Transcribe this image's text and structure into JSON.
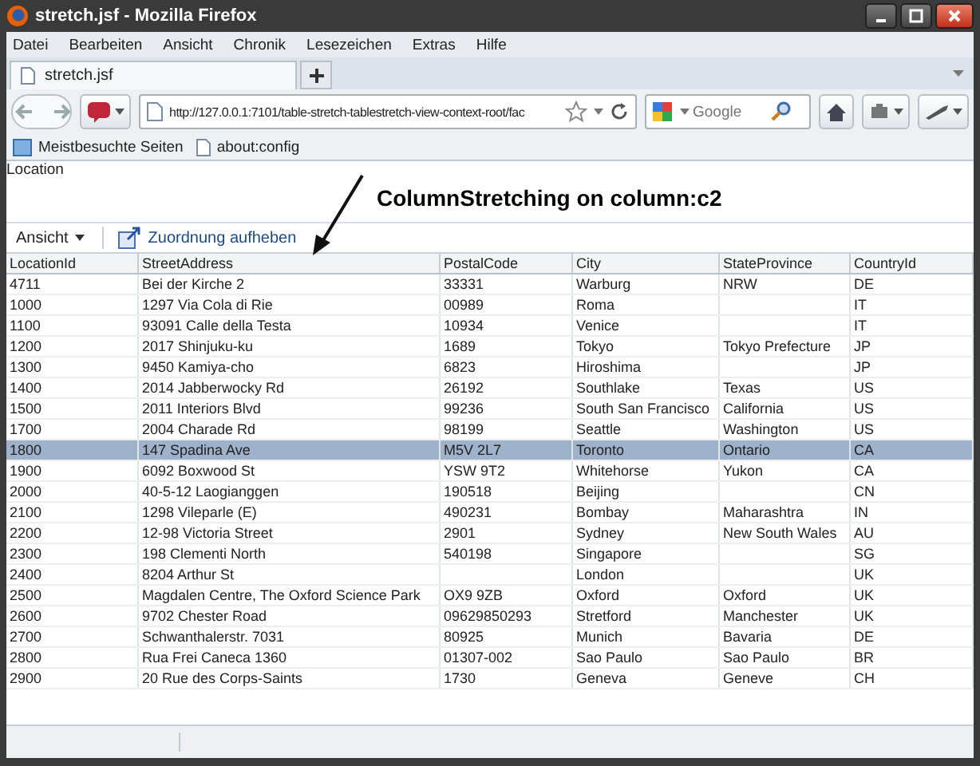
{
  "window": {
    "title": "stretch.jsf - Mozilla Firefox"
  },
  "menu": [
    "Datei",
    "Bearbeiten",
    "Ansicht",
    "Chronik",
    "Lesezeichen",
    "Extras",
    "Hilfe"
  ],
  "tabs": [
    {
      "label": "stretch.jsf",
      "selected": true
    }
  ],
  "address": "http://127.0.0.1:7101/table-stretch-tablestretch-view-context-root/fac",
  "search": {
    "placeholder": "Google"
  },
  "bookmarks": [
    "Meistbesuchte Seiten",
    "about:config"
  ],
  "page": {
    "heading": "Location",
    "annotation": "ColumnStretching on column:c2",
    "view_menu": "Ansicht",
    "detach": "Zuordnung aufheben"
  },
  "table": {
    "columns": [
      "LocationId",
      "StreetAddress",
      "PostalCode",
      "City",
      "StateProvince",
      "CountryId"
    ],
    "rows": [
      {
        "cells": [
          "4711",
          "Bei der Kirche 2",
          "33331",
          "Warburg",
          "NRW",
          "DE"
        ],
        "selected": false
      },
      {
        "cells": [
          "1000",
          "1297 Via Cola di Rie",
          "00989",
          "Roma",
          "",
          "IT"
        ],
        "selected": false
      },
      {
        "cells": [
          "1100",
          "93091 Calle della Testa",
          "10934",
          "Venice",
          "",
          "IT"
        ],
        "selected": false
      },
      {
        "cells": [
          "1200",
          "2017 Shinjuku-ku",
          "1689",
          "Tokyo",
          "Tokyo Prefecture",
          "JP"
        ],
        "selected": false
      },
      {
        "cells": [
          "1300",
          "9450 Kamiya-cho",
          "6823",
          "Hiroshima",
          "",
          "JP"
        ],
        "selected": false
      },
      {
        "cells": [
          "1400",
          "2014 Jabberwocky Rd",
          "26192",
          "Southlake",
          "Texas",
          "US"
        ],
        "selected": false
      },
      {
        "cells": [
          "1500",
          "2011 Interiors Blvd",
          "99236",
          "South San Francisco",
          "California",
          "US"
        ],
        "selected": false
      },
      {
        "cells": [
          "1700",
          "2004 Charade Rd",
          "98199",
          "Seattle",
          "Washington",
          "US"
        ],
        "selected": false
      },
      {
        "cells": [
          "1800",
          "147 Spadina Ave",
          "M5V 2L7",
          "Toronto",
          "Ontario",
          "CA"
        ],
        "selected": true
      },
      {
        "cells": [
          "1900",
          "6092 Boxwood St",
          "YSW 9T2",
          "Whitehorse",
          "Yukon",
          "CA"
        ],
        "selected": false
      },
      {
        "cells": [
          "2000",
          "40-5-12 Laogianggen",
          "190518",
          "Beijing",
          "",
          "CN"
        ],
        "selected": false
      },
      {
        "cells": [
          "2100",
          "1298 Vileparle (E)",
          "490231",
          "Bombay",
          "Maharashtra",
          "IN"
        ],
        "selected": false
      },
      {
        "cells": [
          "2200",
          "12-98 Victoria Street",
          "2901",
          "Sydney",
          "New South Wales",
          "AU"
        ],
        "selected": false
      },
      {
        "cells": [
          "2300",
          "198 Clementi North",
          "540198",
          "Singapore",
          "",
          "SG"
        ],
        "selected": false
      },
      {
        "cells": [
          "2400",
          "8204 Arthur St",
          "",
          "London",
          "",
          "UK"
        ],
        "selected": false
      },
      {
        "cells": [
          "2500",
          "Magdalen Centre, The Oxford Science Park",
          "OX9 9ZB",
          "Oxford",
          "Oxford",
          "UK"
        ],
        "selected": false
      },
      {
        "cells": [
          "2600",
          "9702 Chester Road",
          "09629850293",
          "Stretford",
          "Manchester",
          "UK"
        ],
        "selected": false
      },
      {
        "cells": [
          "2700",
          "Schwanthalerstr. 7031",
          "80925",
          "Munich",
          "Bavaria",
          "DE"
        ],
        "selected": false
      },
      {
        "cells": [
          "2800",
          "Rua Frei Caneca 1360",
          "01307-002",
          "Sao Paulo",
          "Sao Paulo",
          "BR"
        ],
        "selected": false
      },
      {
        "cells": [
          "2900",
          "20 Rue des Corps-Saints",
          "1730",
          "Geneva",
          "Geneve",
          "CH"
        ],
        "selected": false
      }
    ]
  }
}
